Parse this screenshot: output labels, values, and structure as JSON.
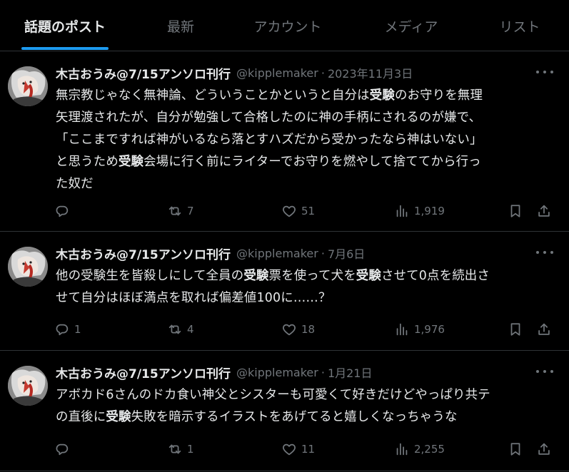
{
  "tabs": [
    {
      "label": "話題のポスト",
      "active": true
    },
    {
      "label": "最新",
      "active": false
    },
    {
      "label": "アカウント",
      "active": false
    },
    {
      "label": "メディア",
      "active": false
    },
    {
      "label": "リスト",
      "active": false
    }
  ],
  "posts": [
    {
      "author": "木古おうみ@7/15アンソロ刊行",
      "handle": "@kipplemaker",
      "sep": "·",
      "date": "2023年11月3日",
      "lines": [
        [
          "無宗教じゃなく無神論、どういうことかというと自分は",
          "受験",
          "のお守りを無理"
        ],
        [
          "矢理渡されたが、自分が勉強して合格したのに神の手柄にされるのが嫌で、"
        ],
        [
          "「ここまですれば神がいるなら落とすハズだから受かったなら神はいない」"
        ],
        [
          "と思うため",
          "受験",
          "会場に行く前にライターでお守りを燃やして捨ててから行っ"
        ],
        [
          "た奴だ"
        ]
      ],
      "replies": "",
      "reposts": "7",
      "likes": "51",
      "views": "1,919"
    },
    {
      "author": "木古おうみ@7/15アンソロ刊行",
      "handle": "@kipplemaker",
      "sep": "·",
      "date": "7月6日",
      "lines": [
        [
          "他の受験生を皆殺しにして全員の",
          "受験",
          "票を使って犬を",
          "受験",
          "させて0点を続出さ"
        ],
        [
          "せて自分はほぼ満点を取れば偏差値100に……？"
        ]
      ],
      "replies": "1",
      "reposts": "4",
      "likes": "18",
      "views": "1,976"
    },
    {
      "author": "木古おうみ@7/15アンソロ刊行",
      "handle": "@kipplemaker",
      "sep": "·",
      "date": "1月21日",
      "lines": [
        [
          "アボカド6さんのドカ食い神父とシスターも可愛くて好きだけどやっぱり共テ"
        ],
        [
          "の直後に",
          "受験",
          "失敗を暗示するイラストをあげてると嬉しくなっちゃうな"
        ]
      ],
      "replies": "",
      "reposts": "1",
      "likes": "11",
      "views": "2,255"
    }
  ]
}
